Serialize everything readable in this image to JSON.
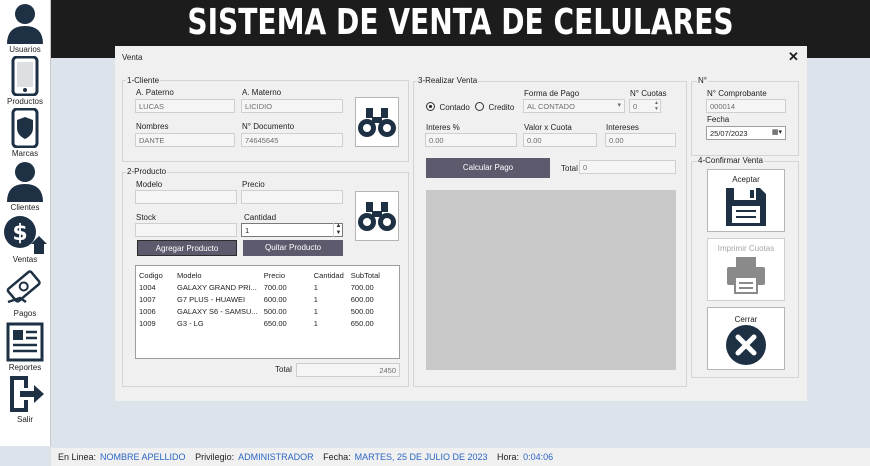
{
  "header": {
    "title": "SISTEMA DE VENTA DE CELULARES"
  },
  "sidebar": {
    "items": [
      {
        "label": "Usuarios",
        "icon": "user-icon"
      },
      {
        "label": "Productos",
        "icon": "phone-icon"
      },
      {
        "label": "Marcas",
        "icon": "shield-icon"
      },
      {
        "label": "Clientes",
        "icon": "user-icon"
      },
      {
        "label": "Ventas",
        "icon": "dollar-icon"
      },
      {
        "label": "Pagos",
        "icon": "pay-icon"
      },
      {
        "label": "Reportes",
        "icon": "report-icon"
      },
      {
        "label": "Salir",
        "icon": "exit-icon"
      }
    ]
  },
  "window": {
    "title": "Venta",
    "close": "✕",
    "cliente": {
      "group": "1-Cliente",
      "paterno_label": "A. Paterno",
      "paterno": "LUCAS",
      "materno_label": "A. Materno",
      "materno": "LICIDIO",
      "nombres_label": "Nombres",
      "nombres": "DANTE",
      "doc_label": "N° Documento",
      "doc": "74645645"
    },
    "producto": {
      "group": "2-Producto",
      "modelo_label": "Modelo",
      "modelo": "",
      "precio_label": "Precio",
      "precio": "",
      "stock_label": "Stock",
      "stock": "",
      "cantidad_label": "Cantidad",
      "cantidad": "1",
      "agregar": "Agregar Producto",
      "quitar": "Quitar Producto",
      "columns": [
        "Codigo",
        "Modelo",
        "Precio",
        "Cantidad",
        "SubTotal"
      ],
      "rows": [
        [
          "1004",
          "GALAXY GRAND PRI...",
          "700.00",
          "1",
          "700.00"
        ],
        [
          "1007",
          "G7 PLUS - HUAWEI",
          "600.00",
          "1",
          "600.00"
        ],
        [
          "1006",
          "GALAXY S6 - SAMSU...",
          "500.00",
          "1",
          "500.00"
        ],
        [
          "1009",
          "G3 - LG",
          "650.00",
          "1",
          "650.00"
        ]
      ],
      "total_label": "Total",
      "total": "2450"
    },
    "venta": {
      "group": "3-Realizar Venta",
      "contado": "Contado",
      "credito": "Credito",
      "forma_label": "Forma de Pago",
      "forma": "AL CONTADO",
      "cuotas_label": "N° Cuotas",
      "cuotas": "0",
      "interes_label": "Interes %",
      "interes": "0.00",
      "valor_label": "Valor x Cuota",
      "valor": "0.00",
      "intereses_label": "Intereses",
      "intereses": "0.00",
      "calcular": "Calcular Pago",
      "total_label": "Total",
      "total": "0"
    },
    "comprobante": {
      "group": "N°",
      "num_label": "N° Comprobante",
      "num": "000014",
      "fecha_label": "Fecha",
      "fecha": "25/07/2023"
    },
    "confirmar": {
      "group": "4-Confirmar Venta",
      "aceptar": "Aceptar",
      "imprimir": "Imprimir Cuotas",
      "cerrar": "Cerrar"
    }
  },
  "status": {
    "linea_label": "En Linea:",
    "linea": "NOMBRE APELLIDO",
    "priv_label": "Privilegio:",
    "priv": "ADMINISTRADOR",
    "fecha_label": "Fecha:",
    "fecha": "MARTES, 25 DE JULIO DE 2023",
    "hora_label": "Hora:",
    "hora": "0:04:06"
  },
  "colors": {
    "accent_button": "#5e5a6d",
    "status_value": "#2a66c4",
    "header_bg": "#1c1c1c",
    "icon_navy": "#1e3044"
  }
}
